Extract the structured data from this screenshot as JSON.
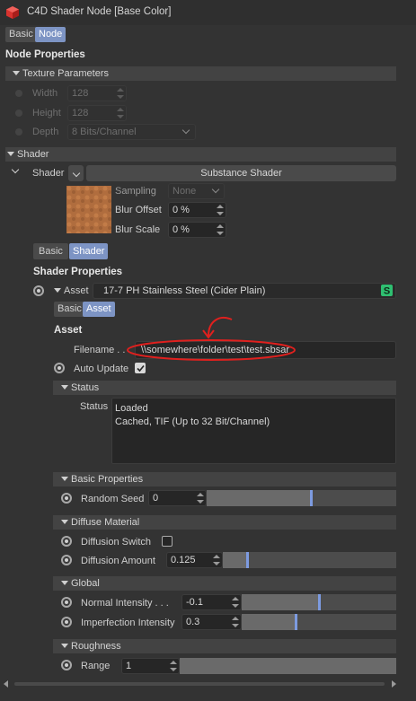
{
  "window": {
    "title": "C4D Shader Node [Base Color]"
  },
  "top_tabs": [
    "Basic",
    "Node"
  ],
  "node_properties": {
    "heading": "Node Properties",
    "texture_params": {
      "label": "Texture Parameters",
      "width_label": "Width",
      "width_value": "128",
      "height_label": "Height",
      "height_value": "128",
      "depth_label": "Depth",
      "depth_value": "8 Bits/Channel"
    }
  },
  "shader": {
    "section_label": "Shader",
    "row_label": "Shader",
    "button_label": "Substance Shader",
    "sampling_label": "Sampling",
    "sampling_value": "None",
    "blur_offset_label": "Blur Offset",
    "blur_offset_value": "0 %",
    "blur_scale_label": "Blur Scale",
    "blur_scale_value": "0 %",
    "tabs": [
      "Basic",
      "Shader"
    ]
  },
  "shader_properties": {
    "heading": "Shader Properties",
    "asset_label": "Asset",
    "asset_value": "17-7 PH Stainless Steel (Cider Plain)",
    "tabs": [
      "Basic",
      "Asset"
    ],
    "asset_heading": "Asset",
    "filename_label": "Filename . . .",
    "filename_value": "\\\\somewhere\\folder\\test\\test.sbsar",
    "auto_update_label": "Auto Update",
    "status_section": "Status",
    "status_label": "Status",
    "status_lines": [
      "Loaded",
      "Cached, TIF (Up to 32 Bit/Channel)"
    ]
  },
  "basic_properties": {
    "section": "Basic Properties",
    "random_seed_label": "Random Seed",
    "random_seed_value": "0",
    "random_seed_fraction": 0.55
  },
  "diffuse_material": {
    "section": "Diffuse Material",
    "diffusion_switch_label": "Diffusion Switch",
    "diffusion_amount_label": "Diffusion Amount",
    "diffusion_amount_value": "0.125",
    "diffusion_amount_fraction": 0.14
  },
  "global": {
    "section": "Global",
    "normal_intensity_label": "Normal Intensity . . .",
    "normal_intensity_value": "-0.1",
    "normal_intensity_fraction": 0.5,
    "imperfection_intensity_label": "Imperfection Intensity",
    "imperfection_intensity_value": "0.3",
    "imperfection_intensity_fraction": 0.35
  },
  "roughness": {
    "section": "Roughness",
    "range_label": "Range",
    "range_value": "1"
  },
  "colors": {
    "accent": "#7d94c4",
    "annotation": "#e0201e",
    "slider_knob": "#7d9be0",
    "substance_green": "#2fbf71"
  }
}
